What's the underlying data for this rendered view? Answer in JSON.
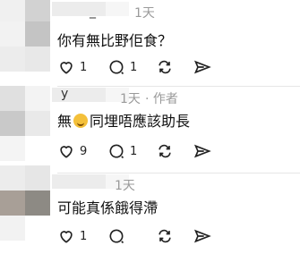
{
  "comments": [
    {
      "username_visible": "_",
      "time": "1天",
      "text": "你有無比野佢食？",
      "likes": "1",
      "replies": "1",
      "avatar_colors": [
        "#f0f0f0",
        "#d2d2d2",
        "#f2f2f2",
        "#c4c4c4",
        "#ececec",
        "#e8e8e8"
      ]
    },
    {
      "username_visible": "y",
      "time": "1天",
      "author_tag": "· 作者",
      "text_prefix": "無",
      "text_suffix": "同埋唔應該助長",
      "likes": "9",
      "replies": "1",
      "avatar_colors": [
        "#e0e0e0",
        "#f3f3f3",
        "#c9c9c9",
        "#e9e9e9",
        "#f4f4f4",
        "#ffffff"
      ]
    },
    {
      "username_visible": "",
      "time": "1天",
      "text": "可能真係餓得滯",
      "likes": "1",
      "replies": "",
      "avatar_colors": [
        "#ececec",
        "#e6e6e6",
        "#a89f97",
        "#8d8a84",
        "#f2f2f2",
        "#ffffff"
      ]
    }
  ],
  "icons": {
    "like": "heart-icon",
    "reply": "comment-bubble-icon",
    "repost": "repost-icon",
    "share": "send-icon"
  }
}
